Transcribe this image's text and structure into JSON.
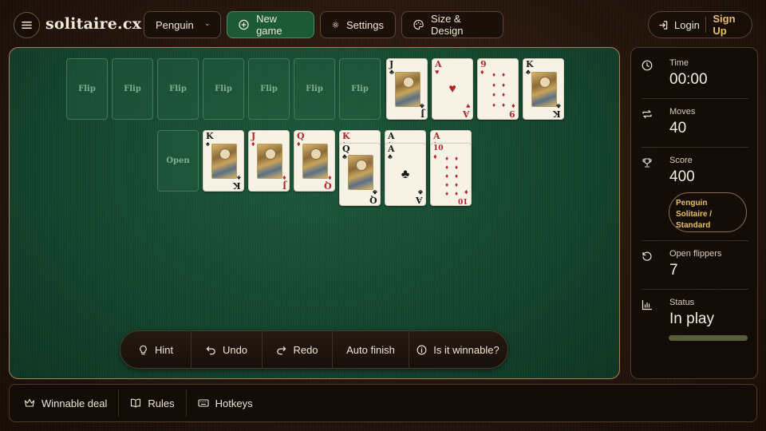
{
  "header": {
    "logo": "solitaire.cx",
    "variant_label": "Penguin",
    "new_game_label": "New game",
    "settings_label": "Settings",
    "size_design_label": "Size & Design",
    "login_label": "Login",
    "signup_label": "Sign Up"
  },
  "board": {
    "top_row": [
      {
        "type": "slot",
        "label": "Flip"
      },
      {
        "type": "slot",
        "label": "Flip"
      },
      {
        "type": "slot",
        "label": "Flip"
      },
      {
        "type": "slot",
        "label": "Flip"
      },
      {
        "type": "slot",
        "label": "Flip"
      },
      {
        "type": "slot",
        "label": "Flip"
      },
      {
        "type": "slot",
        "label": "Flip"
      },
      {
        "type": "card",
        "rank": "J",
        "suit": "♣",
        "color": "black"
      },
      {
        "type": "card",
        "rank": "A",
        "suit": "♥",
        "color": "red"
      },
      {
        "type": "card",
        "rank": "9",
        "suit": "♦",
        "color": "red"
      },
      {
        "type": "card",
        "rank": "K",
        "suit": "♣",
        "color": "black"
      }
    ],
    "open_slot_label": "Open",
    "tableau": [
      {
        "rank": "K",
        "suit": "♠",
        "color": "black"
      },
      {
        "rank": "J",
        "suit": "♦",
        "color": "red"
      },
      {
        "rank": "Q",
        "suit": "♦",
        "color": "red"
      },
      {
        "under_rank": "K",
        "under_suit": "♦",
        "rank": "Q",
        "suit": "♣",
        "color": "black"
      },
      {
        "under_rank": "A",
        "under_suit": "♠",
        "rank": "A",
        "suit": "♣",
        "color": "black"
      },
      {
        "under_rank": "A",
        "under_suit": "♦",
        "rank": "10",
        "suit": "♦",
        "color": "red"
      }
    ]
  },
  "toolbar": {
    "hint_label": "Hint",
    "undo_label": "Undo",
    "redo_label": "Redo",
    "auto_finish_label": "Auto finish",
    "winnable_label": "Is it winnable?"
  },
  "stats": {
    "time_label": "Time",
    "time_value": "00:00",
    "moves_label": "Moves",
    "moves_value": "40",
    "score_label": "Score",
    "score_value": "400",
    "variant_badge": "Penguin Solitaire / Standard",
    "flippers_label": "Open flippers",
    "flippers_value": "7",
    "status_label": "Status",
    "status_value": "In play",
    "status_bar_color": "#55603a"
  },
  "footer": {
    "winnable_deal_label": "Winnable deal",
    "rules_label": "Rules",
    "hotkeys_label": "Hotkeys"
  },
  "colors": {
    "felt": "#1a5036",
    "accent_gold": "#e4c067",
    "new_game_bg": "#1c5a37",
    "card_red": "#b4242b"
  }
}
